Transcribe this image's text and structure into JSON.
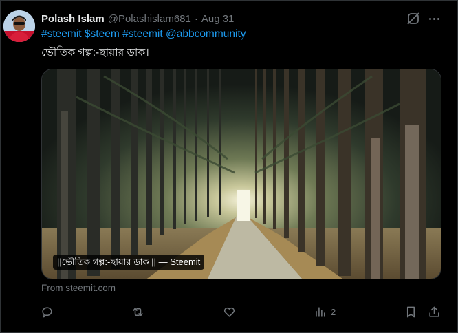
{
  "author": {
    "name": "Polash Islam",
    "handle": "@Polashislam681",
    "separator": "·",
    "date": "Aug 31"
  },
  "tweet": {
    "tags": [
      "#steemit",
      "$steem",
      "#steemit",
      "@abbcommunity"
    ],
    "text": "ভৌতিক গল্প:-ছায়ার ডাক।"
  },
  "card": {
    "label": "||ভৌতিক গল্প:-ছায়ার ডাক || — Steemit",
    "source": "From steemit.com"
  },
  "actions": {
    "views_count": "2"
  },
  "icons": [
    "grok-icon",
    "more-icon",
    "reply-icon",
    "retweet-icon",
    "like-icon",
    "views-icon",
    "bookmark-icon",
    "share-icon"
  ],
  "colors": {
    "accent": "#1d9bf0",
    "muted": "#71767b",
    "text": "#e7e9ea",
    "background": "#000000"
  }
}
